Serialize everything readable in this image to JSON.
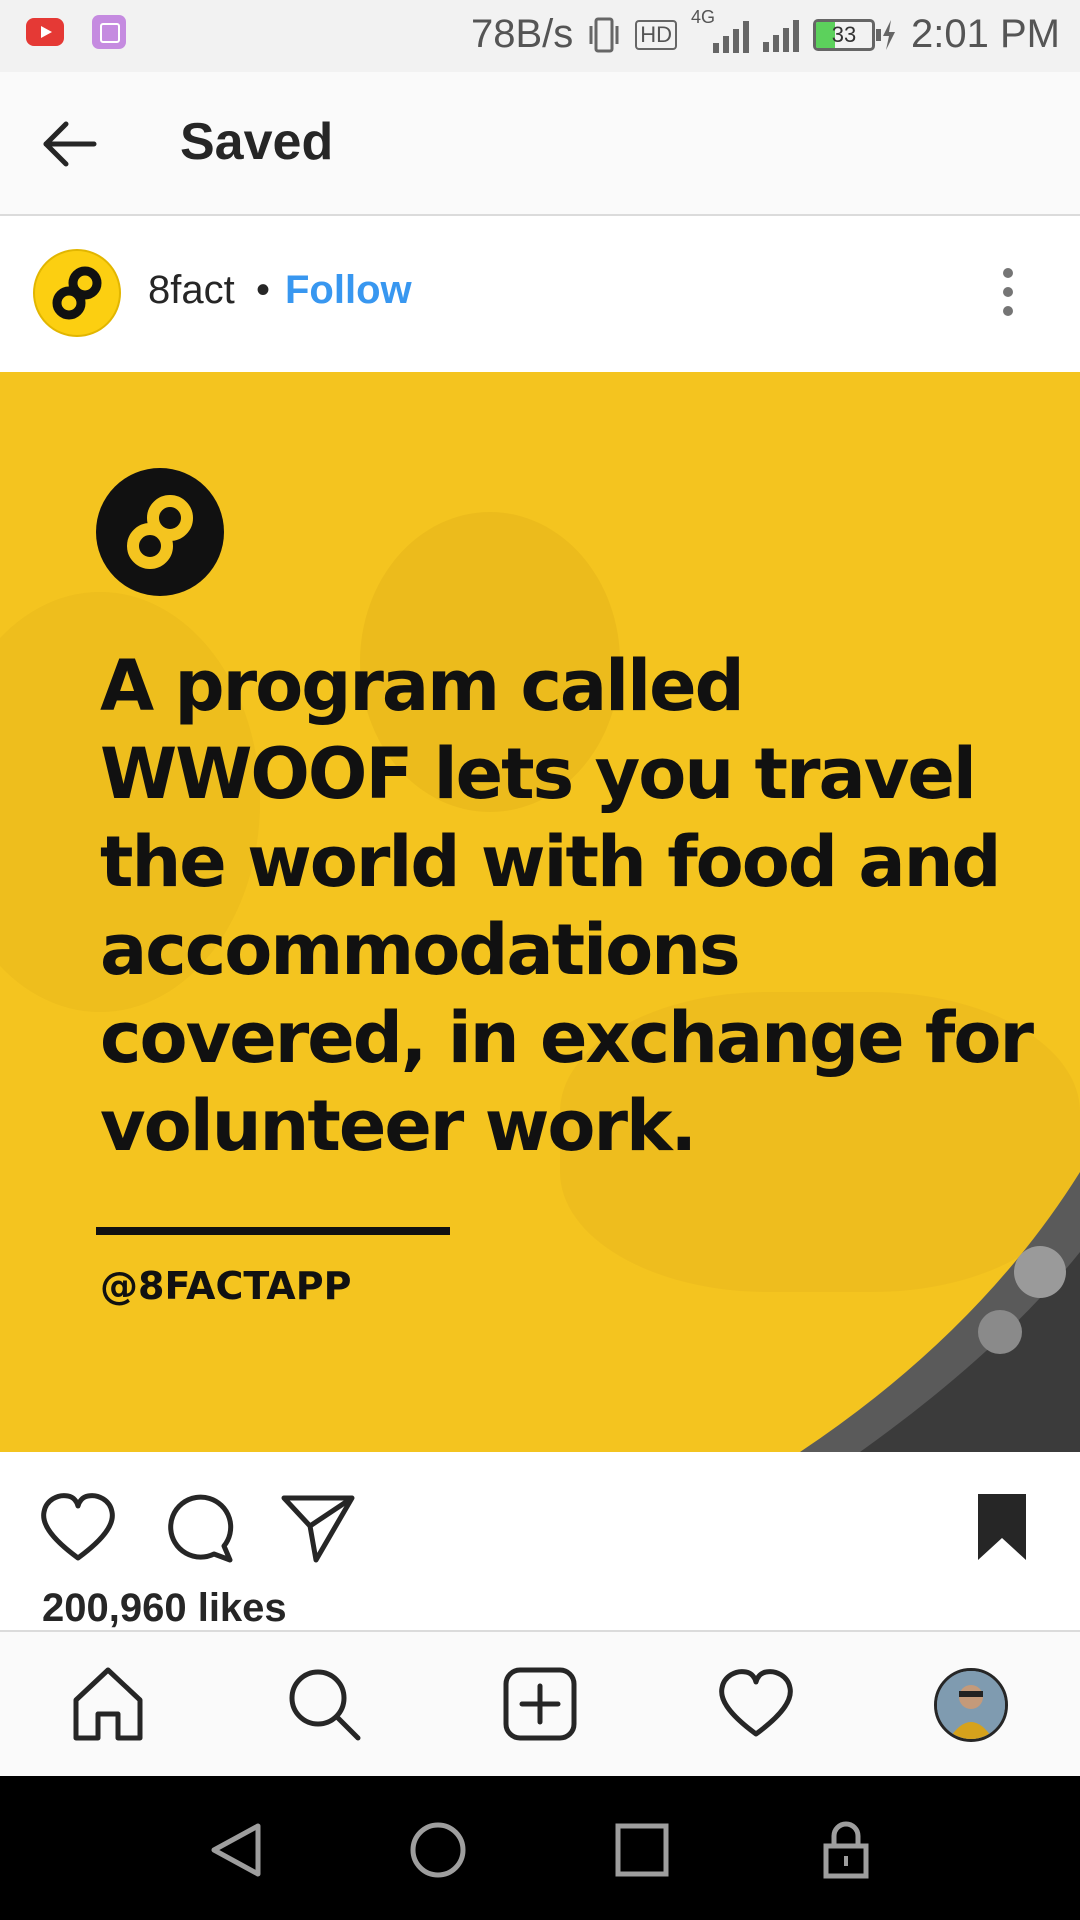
{
  "status_bar": {
    "net_speed": "78B/s",
    "hd_badge": "HD",
    "network_type": "4G",
    "battery_level": "33",
    "time": "2:01 PM"
  },
  "header": {
    "title": "Saved",
    "back_icon": "arrow-left-icon"
  },
  "post": {
    "username": "8fact",
    "separator": "•",
    "follow_label": "Follow",
    "image": {
      "text_lines": [
        "A program called",
        "WWOOF lets you travel",
        "the world with food and",
        "accommodations",
        "covered, in exchange for",
        "volunteer work."
      ],
      "handle": "@8FACTAPP",
      "colors": {
        "background": "#f4c41f",
        "text": "#111111"
      }
    },
    "likes": "200,960 likes"
  },
  "actions": {
    "icons": [
      "heart-icon",
      "comment-icon",
      "share-icon",
      "bookmark-icon"
    ]
  },
  "bottom_nav": {
    "icons": [
      "home-icon",
      "search-icon",
      "add-post-icon",
      "activity-heart-icon",
      "profile-avatar"
    ]
  },
  "system_nav": {
    "icons": [
      "back-triangle-icon",
      "home-circle-icon",
      "recents-square-icon",
      "lock-icon"
    ]
  },
  "colors": {
    "accent": "#3897f0",
    "brand_yellow": "#f4c41f"
  }
}
